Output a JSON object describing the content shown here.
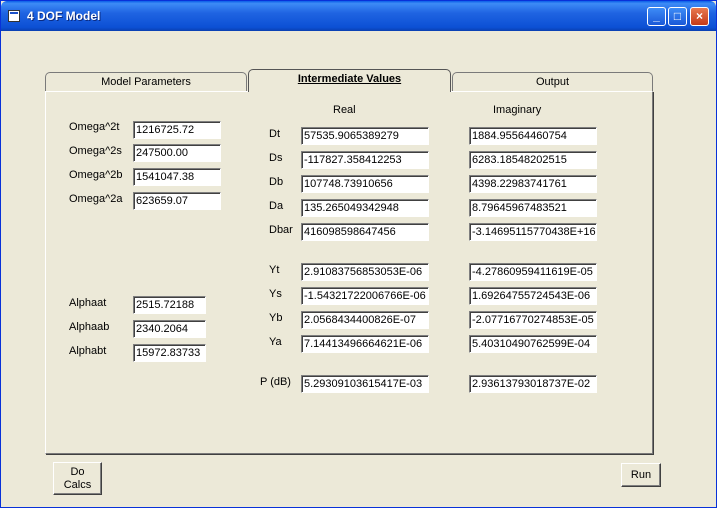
{
  "window": {
    "title": "4 DOF Model"
  },
  "tabs": [
    {
      "label": "Model Parameters"
    },
    {
      "label": "Intermediate Values"
    },
    {
      "label": "Output"
    }
  ],
  "columns": {
    "real": "Real",
    "imaginary": "Imaginary"
  },
  "omega": [
    {
      "label": "Omega^2t",
      "value": "1216725.72"
    },
    {
      "label": "Omega^2s",
      "value": "247500.00"
    },
    {
      "label": "Omega^2b",
      "value": "1541047.38"
    },
    {
      "label": "Omega^2a",
      "value": "623659.07"
    }
  ],
  "alpha": [
    {
      "label": "Alphaat",
      "value": "2515.72188"
    },
    {
      "label": "Alphaab",
      "value": "2340.2064"
    },
    {
      "label": "Alphabt",
      "value": "15972.83733"
    }
  ],
  "d_rows": [
    {
      "label": "Dt",
      "real": "57535.9065389279",
      "imag": "1884.95564460754"
    },
    {
      "label": "Ds",
      "real": "-117827.358412253",
      "imag": "6283.18548202515"
    },
    {
      "label": "Db",
      "real": "107748.73910656",
      "imag": "4398.22983741761"
    },
    {
      "label": "Da",
      "real": "135.265049342948",
      "imag": "8.79645967483521"
    },
    {
      "label": "Dbar",
      "real": "416098598647456",
      "imag": "-3.14695115770438E+16"
    }
  ],
  "y_rows": [
    {
      "label": "Yt",
      "real": "2.91083756853053E-06",
      "imag": "-4.27860959411619E-05"
    },
    {
      "label": "Ys",
      "real": "-1.54321722006766E-06",
      "imag": "1.69264755724543E-06"
    },
    {
      "label": "Yb",
      "real": "2.0568434400826E-07",
      "imag": "-2.07716770274853E-05"
    },
    {
      "label": "Ya",
      "real": "7.14413496664621E-06",
      "imag": "5.40310490762599E-04"
    }
  ],
  "p_row": {
    "label": "P (dB)",
    "real": "5.29309103615417E-03",
    "imag": "2.93613793018737E-02"
  },
  "buttons": {
    "do_calcs_line1": "Do",
    "do_calcs_line2": "Calcs",
    "run": "Run"
  }
}
